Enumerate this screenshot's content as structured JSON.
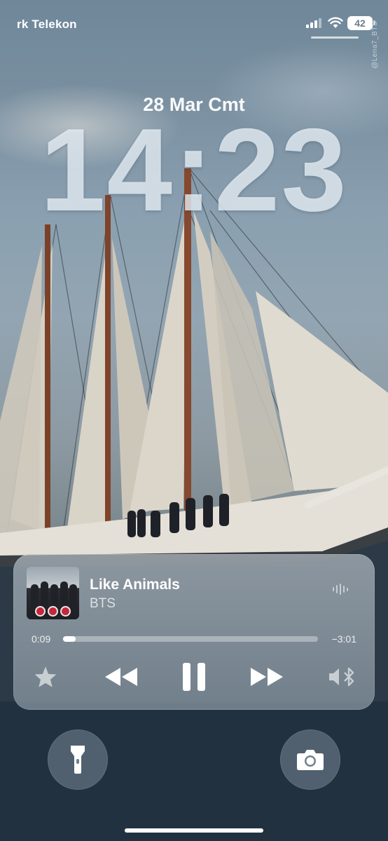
{
  "status_bar": {
    "carrier": "rk Telekon",
    "battery_level": "42",
    "signal_bars": 3,
    "signal_bars_total": 4
  },
  "watermark": "@Lena7_BTS",
  "lock_screen": {
    "date": "28 Mar Cmt",
    "time": "14:23"
  },
  "now_playing": {
    "title": "Like Animals",
    "artist": "BTS",
    "elapsed": "0:09",
    "remaining": "−3:01",
    "progress_fraction": 0.05,
    "icons": {
      "waveform": "waveform-icon",
      "favorite": "star-icon",
      "previous": "rewind-icon",
      "play_pause": "pause-icon",
      "next": "fast-forward-icon",
      "output": "speaker-bluetooth-icon"
    }
  },
  "quick_actions": {
    "left": "flashlight-icon",
    "right": "camera-icon"
  },
  "colors": {
    "widget_bg": "#a5b2be",
    "album_seal": "#c4283a",
    "battery_text": "#6b7d8c"
  }
}
